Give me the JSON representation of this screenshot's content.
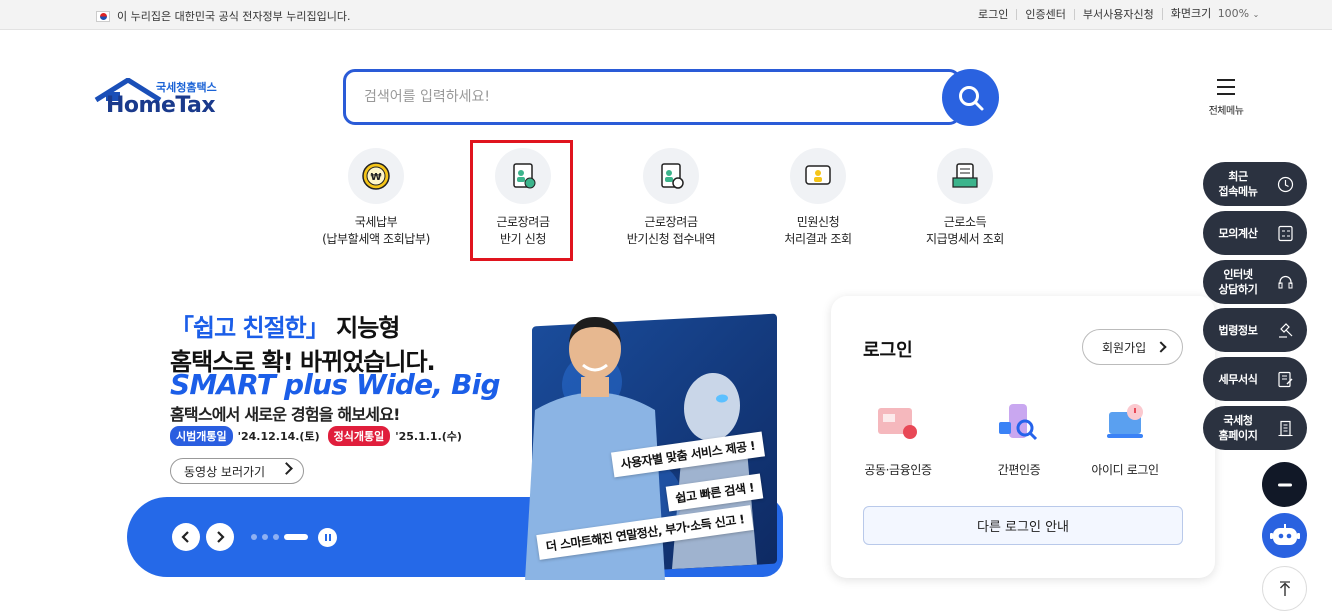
{
  "topbar": {
    "gov_notice": "이 누리집은 대한민국 공식 전자정부 누리집입니다.",
    "links": [
      "로그인",
      "인증센터",
      "부서사용자신청"
    ],
    "zoom_label": "화면크기",
    "zoom_value": "100%"
  },
  "header": {
    "logo_sub": "국세청홈택스",
    "logo_main": "HomeTax",
    "search_placeholder": "검색어를 입력하세요!",
    "all_menu_label": "전체메뉴"
  },
  "quick_menu": [
    {
      "line1": "국세납부",
      "line2": "(납부할세액 조회납부)",
      "icon": "won-coin-icon"
    },
    {
      "line1": "근로장려금",
      "line2": "반기 신청",
      "icon": "application-form-icon",
      "highlighted": true
    },
    {
      "line1": "근로장려금",
      "line2": "반기신청 접수내역",
      "icon": "application-receipt-icon"
    },
    {
      "line1": "민원신청",
      "line2": "처리결과 조회",
      "icon": "civil-petition-icon"
    },
    {
      "line1": "근로소득",
      "line2": "지급명세서 조회",
      "icon": "document-tray-icon"
    }
  ],
  "banner": {
    "headline_quote": "「쉽고 친절한」",
    "headline_rest": " 지능형",
    "line2": "홈택스로 확! 바뀌었습니다.",
    "line3": "SMART plus Wide, Big",
    "line4": "홈택스에서 새로운 경험을 해보세요!",
    "trial_label": "시범개통일",
    "trial_date": "'24.12.14.(토)",
    "official_label": "정식개통일",
    "official_date": "'25.1.1.(수)",
    "video_button": "동영상 보러가기",
    "captions": [
      "사용자별 맞춤 서비스 제공 !",
      "쉽고 빠른 검색 !",
      "더 스마트해진 연말정산, 부가·소득 신고 !"
    ],
    "slide_count": 4,
    "active_slide": 4
  },
  "login": {
    "title": "로그인",
    "join_label": "회원가입",
    "options": [
      "공동·금융인증",
      "간편인증",
      "아이디 로그인"
    ],
    "other_login": "다른 로그인 안내"
  },
  "side_menu": [
    {
      "line1": "최근",
      "line2": "접속메뉴",
      "icon": "clock-icon"
    },
    {
      "line1": "모의계산",
      "line2": "",
      "icon": "calculator-icon"
    },
    {
      "line1": "인터넷",
      "line2": "상담하기",
      "icon": "headset-icon"
    },
    {
      "line1": "법령정보",
      "line2": "",
      "icon": "gavel-icon"
    },
    {
      "line1": "세무서식",
      "line2": "",
      "icon": "form-edit-icon"
    },
    {
      "line1": "국세청",
      "line2": "홈페이지",
      "icon": "building-icon"
    }
  ],
  "colors": {
    "brand_blue": "#2a5bd7",
    "highlight_red": "#e0141e",
    "side_bg": "#2b3240"
  }
}
